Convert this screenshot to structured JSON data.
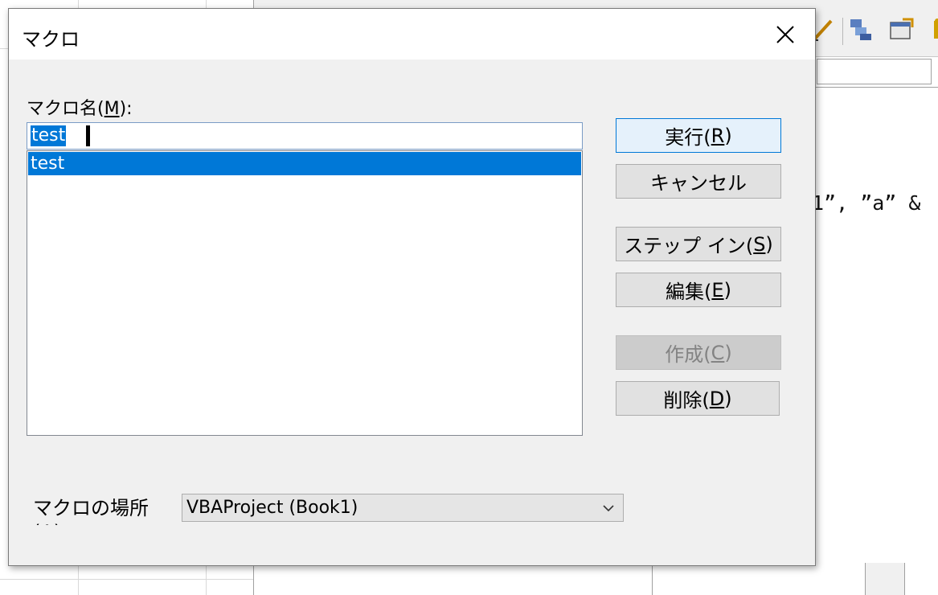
{
  "dialog": {
    "title": "マクロ",
    "macro_name_label_prefix": "マクロ名(",
    "macro_name_label_key": "M",
    "macro_name_label_suffix": "):",
    "macro_name_value": "test",
    "macro_list": [
      "test"
    ],
    "buttons": {
      "run": {
        "prefix": "実行(",
        "key": "R",
        "suffix": ")"
      },
      "cancel": {
        "label": "キャンセル"
      },
      "step_in": {
        "prefix": "ステップ イン(",
        "key": "S",
        "suffix": ")"
      },
      "edit": {
        "prefix": "編集(",
        "key": "E",
        "suffix": ")"
      },
      "create": {
        "prefix": "作成(",
        "key": "C",
        "suffix": ")"
      },
      "delete": {
        "prefix": "削除(",
        "key": "D",
        "suffix": ")"
      }
    },
    "macro_location_label": "マクロの場所(A)",
    "macro_location_value": "VBAProject (Book1)"
  },
  "background": {
    "code_fragment": "1”, ”a” &"
  },
  "colors": {
    "selection": "#0078d7",
    "dialog_bg": "#f0f0f0",
    "default_button_border": "#0078d7"
  }
}
